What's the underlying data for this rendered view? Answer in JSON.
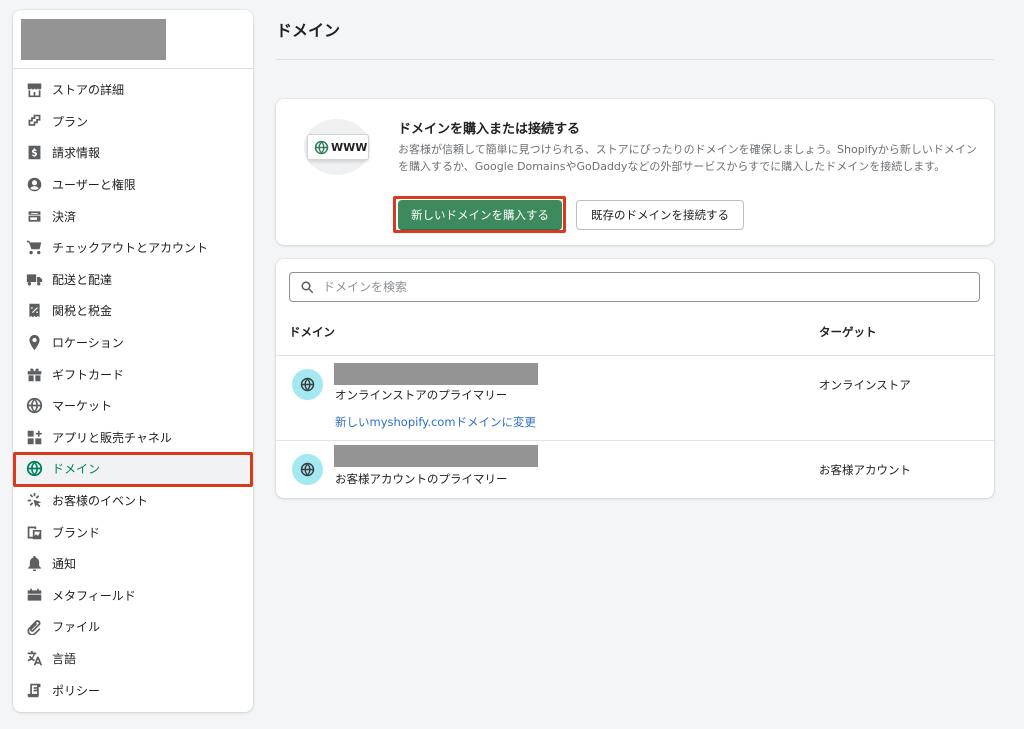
{
  "page": {
    "title": "ドメイン"
  },
  "sidebar": {
    "items": [
      {
        "label": "ストアの詳細",
        "icon": "store-icon"
      },
      {
        "label": "プラン",
        "icon": "plan-icon"
      },
      {
        "label": "請求情報",
        "icon": "billing-icon"
      },
      {
        "label": "ユーザーと権限",
        "icon": "user-icon"
      },
      {
        "label": "決済",
        "icon": "payments-icon"
      },
      {
        "label": "チェックアウトとアカウント",
        "icon": "cart-icon"
      },
      {
        "label": "配送と配達",
        "icon": "truck-icon"
      },
      {
        "label": "関税と税金",
        "icon": "tax-icon"
      },
      {
        "label": "ロケーション",
        "icon": "location-icon"
      },
      {
        "label": "ギフトカード",
        "icon": "gift-icon"
      },
      {
        "label": "マーケット",
        "icon": "globe-icon"
      },
      {
        "label": "アプリと販売チャネル",
        "icon": "apps-icon"
      },
      {
        "label": "ドメイン",
        "icon": "domain-globe-icon",
        "active": true
      },
      {
        "label": "お客様のイベント",
        "icon": "cursor-click-icon"
      },
      {
        "label": "ブランド",
        "icon": "brand-icon"
      },
      {
        "label": "通知",
        "icon": "bell-icon"
      },
      {
        "label": "メタフィールド",
        "icon": "metafield-icon"
      },
      {
        "label": "ファイル",
        "icon": "paperclip-icon"
      },
      {
        "label": "言語",
        "icon": "language-icon"
      },
      {
        "label": "ポリシー",
        "icon": "policy-icon"
      }
    ]
  },
  "promo": {
    "illustration_text": "WWW",
    "title": "ドメインを購入または接続する",
    "description": "お客様が信頼して簡単に見つけられる、ストアにぴったりのドメインを確保しましょう。Shopifyから新しいドメインを購入するか、Google DomainsやGoDaddyなどの外部サービスからすでに購入したドメインを接続します。",
    "buy_button": "新しいドメインを購入する",
    "connect_button": "既存のドメインを接続する"
  },
  "domains": {
    "search_placeholder": "ドメインを検索",
    "columns": {
      "domain": "ドメイン",
      "target": "ターゲット"
    },
    "rows": [
      {
        "subtitle": "オンラインストアのプライマリー",
        "link": "新しいmyshopify.comドメインに変更",
        "target": "オンラインストア"
      },
      {
        "subtitle": "お客様アカウントのプライマリー",
        "target": "お客様アカウント"
      }
    ]
  },
  "colors": {
    "accent": "#008060",
    "primary_button": "#3d8a5e",
    "highlight": "#d63b1f",
    "globe_bg": "#a4e8f2",
    "link": "#2c6ecb"
  }
}
